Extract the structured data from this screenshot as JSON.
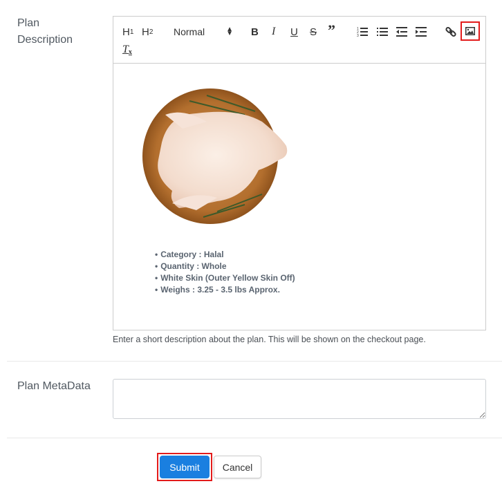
{
  "description": {
    "label": "Plan Description",
    "toolbar": {
      "h1": "H",
      "h1_sub": "1",
      "h2": "H",
      "h2_sub": "2",
      "format_picker": "Normal",
      "bold": "B",
      "italic": "I",
      "underline": "U",
      "strike": "S",
      "blockquote": "”",
      "clear_format": "T",
      "icons": [
        "header-1-icon",
        "header-2-icon",
        "bold-icon",
        "italic-icon",
        "underline-icon",
        "strike-icon",
        "blockquote-icon",
        "ordered-list-icon",
        "bullet-list-icon",
        "outdent-icon",
        "indent-icon",
        "link-icon",
        "image-icon",
        "clear-format-icon"
      ]
    },
    "content": {
      "image_alt": "Whole raw chicken on wooden board with rosemary",
      "bullets": [
        "Category : Halal",
        "Quantity : Whole",
        "White Skin (Outer Yellow Skin Off)",
        "Weighs : 3.25 - 3.5 lbs Approx."
      ]
    },
    "help_text": "Enter a short description about the plan. This will be shown on the checkout page."
  },
  "metadata": {
    "label": "Plan MetaData",
    "value": ""
  },
  "actions": {
    "submit_label": "Submit",
    "cancel_label": "Cancel"
  },
  "colors": {
    "primary": "#1a7fe0",
    "highlight": "#e31b1b"
  }
}
